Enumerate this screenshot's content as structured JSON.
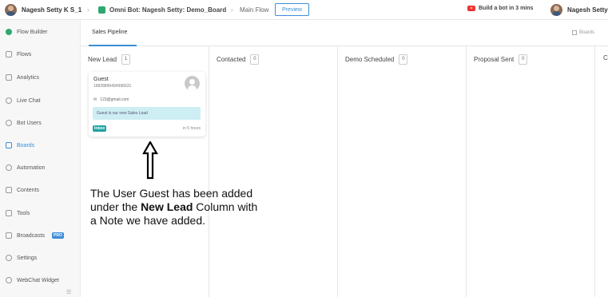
{
  "topbar": {
    "user_name": "Nagesh Setty K S_1",
    "bot_title": "Omni Bot: Nagesh Setty: Demo_Board",
    "flow": "Main Flow",
    "preview_label": "Preview",
    "build_bot": "Build a bot in 3 mins",
    "user_name_right": "Nagesh Setty"
  },
  "sidebar": {
    "items": [
      {
        "label": "Flow Builder",
        "icon": "flow-builder-icon"
      },
      {
        "label": "Flows",
        "icon": "flows-icon"
      },
      {
        "label": "Analytics",
        "icon": "analytics-icon"
      },
      {
        "label": "Live Chat",
        "icon": "live-chat-icon"
      },
      {
        "label": "Bot Users",
        "icon": "bot-users-icon"
      },
      {
        "label": "Boards",
        "icon": "boards-icon",
        "active": true
      },
      {
        "label": "Automation",
        "icon": "automation-icon"
      },
      {
        "label": "Contents",
        "icon": "contents-icon"
      },
      {
        "label": "Tools",
        "icon": "tools-icon"
      },
      {
        "label": "Broadcasts",
        "icon": "broadcasts-icon",
        "badge": "PRO"
      },
      {
        "label": "Settings",
        "icon": "settings-icon"
      },
      {
        "label": "WebChat Widget",
        "icon": "webchat-icon"
      }
    ]
  },
  "subheader": {
    "tab": "Sales Pipeline",
    "boards_link": "Boards"
  },
  "columns": [
    {
      "title": "New Lead",
      "count": "1"
    },
    {
      "title": "Contacted",
      "count": "0"
    },
    {
      "title": "Demo Scheduled",
      "count": "0"
    },
    {
      "title": "Proposal Sent",
      "count": "0"
    },
    {
      "title": "C",
      "count": ""
    }
  ],
  "card": {
    "name": "Guest",
    "phone": "16828890494996631",
    "email": "123@gmail.com",
    "note": "Guest is our new Sales Lead",
    "badge": "Inbox",
    "time": "in 5 hours"
  },
  "annotation": {
    "line1": "The User Guest has been added",
    "line2_pre": "under the ",
    "line2_bold": "New Lead",
    "line2_post": " Column with",
    "line3": "a Note we have added."
  },
  "colors": {
    "accent": "#3b8ed6",
    "note_bg": "#cdeef3",
    "badge": "#1fa3a3"
  }
}
